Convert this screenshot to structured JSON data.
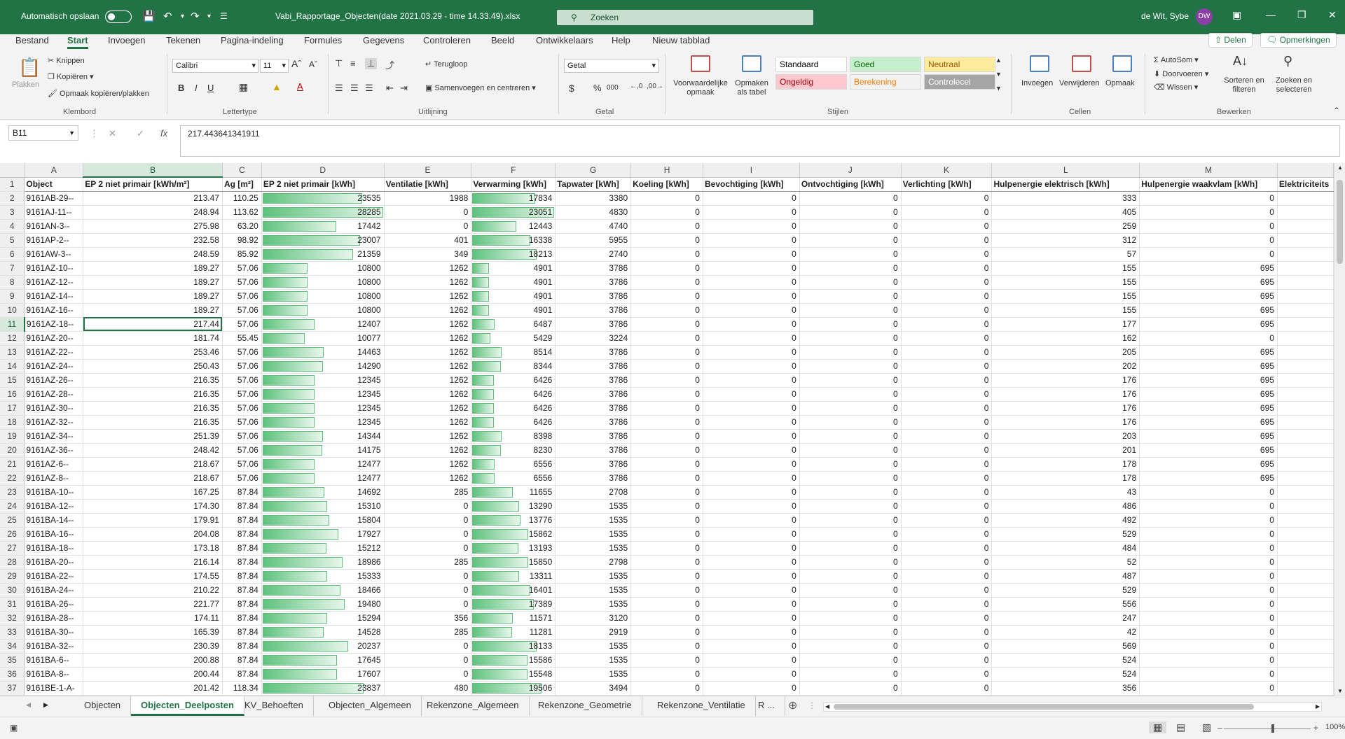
{
  "titlebar": {
    "autosave_label": "Automatisch opslaan",
    "doc_title": "Vabi_Rapportage_Objecten(date 2021.03.29 - time 14.33.49).xlsx",
    "search_placeholder": "Zoeken",
    "user_name": "de Wit, Sybe",
    "user_initials": "DW"
  },
  "tabs": [
    "Bestand",
    "Start",
    "Invoegen",
    "Tekenen",
    "Pagina-indeling",
    "Formules",
    "Gegevens",
    "Controleren",
    "Beeld",
    "Ontwikkelaars",
    "Help",
    "Nieuw tabblad"
  ],
  "active_tab": "Start",
  "share": {
    "share_label": "Delen",
    "comments_label": "Opmerkingen"
  },
  "ribbon": {
    "clipboard": {
      "paste": "Plakken",
      "cut": "Knippen",
      "copy": "Kopiëren",
      "format_painter": "Opmaak kopiëren/plakken",
      "group": "Klembord"
    },
    "font": {
      "family": "Calibri",
      "size": "11",
      "group": "Lettertype"
    },
    "alignment": {
      "wrap": "Terugloop",
      "merge": "Samenvoegen en centreren",
      "group": "Uitlijning"
    },
    "number": {
      "format": "Getal",
      "group": "Getal"
    },
    "styles": {
      "conditional": "Voorwaardelijke opmaak",
      "as_table": "Opmaken als tabel",
      "cells": [
        {
          "label": "Standaard",
          "bg": "#ffffff",
          "fg": "#000000"
        },
        {
          "label": "Goed",
          "bg": "#c6efce",
          "fg": "#006100"
        },
        {
          "label": "Neutraal",
          "bg": "#ffeb9c",
          "fg": "#9c5700"
        },
        {
          "label": "Ongeldig",
          "bg": "#ffc7ce",
          "fg": "#9c0006"
        },
        {
          "label": "Berekening",
          "bg": "#f2f2f2",
          "fg": "#fa7d00"
        },
        {
          "label": "Controlecel",
          "bg": "#a5a5a5",
          "fg": "#ffffff"
        }
      ],
      "group": "Stijlen"
    },
    "cells": {
      "insert": "Invoegen",
      "delete": "Verwijderen",
      "format": "Opmaak",
      "group": "Cellen"
    },
    "editing": {
      "autosum": "AutoSom",
      "fill": "Doorvoeren",
      "clear": "Wissen",
      "sort": "Sorteren en filteren",
      "find": "Zoeken en selecteren",
      "group": "Bewerken"
    }
  },
  "formula": {
    "name_box": "B11",
    "value": "217.443641341911"
  },
  "columns": [
    "A",
    "B",
    "C",
    "D",
    "E",
    "F",
    "G",
    "H",
    "I",
    "J",
    "K",
    "L",
    "M",
    ""
  ],
  "headers": [
    "Object",
    "EP 2 niet primair [kWh/m²]",
    "Ag [m²]",
    "EP 2 niet primair [kWh]",
    "Ventilatie [kWh]",
    "Verwarming [kWh]",
    "Tapwater [kWh]",
    "Koeling [kWh]",
    "Bevochtiging [kWh]",
    "Ontvochtiging [kWh]",
    "Verlichting [kWh]",
    "Hulpenergie elektrisch [kWh]",
    "Hulpenergie waakvlam [kWh]",
    "Elektriciteits"
  ],
  "rows": [
    [
      "9161AB-29--",
      "213.47",
      "110.25",
      "23535",
      "1988",
      "17834",
      "3380",
      "0",
      "0",
      "0",
      "0",
      "333",
      "0"
    ],
    [
      "9161AJ-11--",
      "248.94",
      "113.62",
      "28285",
      "0",
      "23051",
      "4830",
      "0",
      "0",
      "0",
      "0",
      "405",
      "0"
    ],
    [
      "9161AN-3--",
      "275.98",
      "63.20",
      "17442",
      "0",
      "12443",
      "4740",
      "0",
      "0",
      "0",
      "0",
      "259",
      "0"
    ],
    [
      "9161AP-2--",
      "232.58",
      "98.92",
      "23007",
      "401",
      "16338",
      "5955",
      "0",
      "0",
      "0",
      "0",
      "312",
      "0"
    ],
    [
      "9161AW-3--",
      "248.59",
      "85.92",
      "21359",
      "349",
      "18213",
      "2740",
      "0",
      "0",
      "0",
      "0",
      "57",
      "0"
    ],
    [
      "9161AZ-10--",
      "189.27",
      "57.06",
      "10800",
      "1262",
      "4901",
      "3786",
      "0",
      "0",
      "0",
      "0",
      "155",
      "695"
    ],
    [
      "9161AZ-12--",
      "189.27",
      "57.06",
      "10800",
      "1262",
      "4901",
      "3786",
      "0",
      "0",
      "0",
      "0",
      "155",
      "695"
    ],
    [
      "9161AZ-14--",
      "189.27",
      "57.06",
      "10800",
      "1262",
      "4901",
      "3786",
      "0",
      "0",
      "0",
      "0",
      "155",
      "695"
    ],
    [
      "9161AZ-16--",
      "189.27",
      "57.06",
      "10800",
      "1262",
      "4901",
      "3786",
      "0",
      "0",
      "0",
      "0",
      "155",
      "695"
    ],
    [
      "9161AZ-18--",
      "217.44",
      "57.06",
      "12407",
      "1262",
      "6487",
      "3786",
      "0",
      "0",
      "0",
      "0",
      "177",
      "695"
    ],
    [
      "9161AZ-20--",
      "181.74",
      "55.45",
      "10077",
      "1262",
      "5429",
      "3224",
      "0",
      "0",
      "0",
      "0",
      "162",
      "0"
    ],
    [
      "9161AZ-22--",
      "253.46",
      "57.06",
      "14463",
      "1262",
      "8514",
      "3786",
      "0",
      "0",
      "0",
      "0",
      "205",
      "695"
    ],
    [
      "9161AZ-24--",
      "250.43",
      "57.06",
      "14290",
      "1262",
      "8344",
      "3786",
      "0",
      "0",
      "0",
      "0",
      "202",
      "695"
    ],
    [
      "9161AZ-26--",
      "216.35",
      "57.06",
      "12345",
      "1262",
      "6426",
      "3786",
      "0",
      "0",
      "0",
      "0",
      "176",
      "695"
    ],
    [
      "9161AZ-28--",
      "216.35",
      "57.06",
      "12345",
      "1262",
      "6426",
      "3786",
      "0",
      "0",
      "0",
      "0",
      "176",
      "695"
    ],
    [
      "9161AZ-30--",
      "216.35",
      "57.06",
      "12345",
      "1262",
      "6426",
      "3786",
      "0",
      "0",
      "0",
      "0",
      "176",
      "695"
    ],
    [
      "9161AZ-32--",
      "216.35",
      "57.06",
      "12345",
      "1262",
      "6426",
      "3786",
      "0",
      "0",
      "0",
      "0",
      "176",
      "695"
    ],
    [
      "9161AZ-34--",
      "251.39",
      "57.06",
      "14344",
      "1262",
      "8398",
      "3786",
      "0",
      "0",
      "0",
      "0",
      "203",
      "695"
    ],
    [
      "9161AZ-36--",
      "248.42",
      "57.06",
      "14175",
      "1262",
      "8230",
      "3786",
      "0",
      "0",
      "0",
      "0",
      "201",
      "695"
    ],
    [
      "9161AZ-6--",
      "218.67",
      "57.06",
      "12477",
      "1262",
      "6556",
      "3786",
      "0",
      "0",
      "0",
      "0",
      "178",
      "695"
    ],
    [
      "9161AZ-8--",
      "218.67",
      "57.06",
      "12477",
      "1262",
      "6556",
      "3786",
      "0",
      "0",
      "0",
      "0",
      "178",
      "695"
    ],
    [
      "9161BA-10--",
      "167.25",
      "87.84",
      "14692",
      "285",
      "11655",
      "2708",
      "0",
      "0",
      "0",
      "0",
      "43",
      "0"
    ],
    [
      "9161BA-12--",
      "174.30",
      "87.84",
      "15310",
      "0",
      "13290",
      "1535",
      "0",
      "0",
      "0",
      "0",
      "486",
      "0"
    ],
    [
      "9161BA-14--",
      "179.91",
      "87.84",
      "15804",
      "0",
      "13776",
      "1535",
      "0",
      "0",
      "0",
      "0",
      "492",
      "0"
    ],
    [
      "9161BA-16--",
      "204.08",
      "87.84",
      "17927",
      "0",
      "15862",
      "1535",
      "0",
      "0",
      "0",
      "0",
      "529",
      "0"
    ],
    [
      "9161BA-18--",
      "173.18",
      "87.84",
      "15212",
      "0",
      "13193",
      "1535",
      "0",
      "0",
      "0",
      "0",
      "484",
      "0"
    ],
    [
      "9161BA-20--",
      "216.14",
      "87.84",
      "18986",
      "285",
      "15850",
      "2798",
      "0",
      "0",
      "0",
      "0",
      "52",
      "0"
    ],
    [
      "9161BA-22--",
      "174.55",
      "87.84",
      "15333",
      "0",
      "13311",
      "1535",
      "0",
      "0",
      "0",
      "0",
      "487",
      "0"
    ],
    [
      "9161BA-24--",
      "210.22",
      "87.84",
      "18466",
      "0",
      "16401",
      "1535",
      "0",
      "0",
      "0",
      "0",
      "529",
      "0"
    ],
    [
      "9161BA-26--",
      "221.77",
      "87.84",
      "19480",
      "0",
      "17389",
      "1535",
      "0",
      "0",
      "0",
      "0",
      "556",
      "0"
    ],
    [
      "9161BA-28--",
      "174.11",
      "87.84",
      "15294",
      "356",
      "11571",
      "3120",
      "0",
      "0",
      "0",
      "0",
      "247",
      "0"
    ],
    [
      "9161BA-30--",
      "165.39",
      "87.84",
      "14528",
      "285",
      "11281",
      "2919",
      "0",
      "0",
      "0",
      "0",
      "42",
      "0"
    ],
    [
      "9161BA-32--",
      "230.39",
      "87.84",
      "20237",
      "0",
      "18133",
      "1535",
      "0",
      "0",
      "0",
      "0",
      "569",
      "0"
    ],
    [
      "9161BA-6--",
      "200.88",
      "87.84",
      "17645",
      "0",
      "15586",
      "1535",
      "0",
      "0",
      "0",
      "0",
      "524",
      "0"
    ],
    [
      "9161BA-8--",
      "200.44",
      "87.84",
      "17607",
      "0",
      "15548",
      "1535",
      "0",
      "0",
      "0",
      "0",
      "524",
      "0"
    ],
    [
      "9161BE-1-A-",
      "201.42",
      "118.34",
      "23837",
      "480",
      "19506",
      "3494",
      "0",
      "0",
      "0",
      "0",
      "356",
      "0"
    ]
  ],
  "data_bars": {
    "D": {
      "max": 28285
    },
    "F": {
      "max": 23051
    }
  },
  "selected": {
    "row": 11,
    "col": "B"
  },
  "sheets": [
    "Objecten",
    "Objecten_Deelposten",
    "KV_Behoeften",
    "Objecten_Algemeen",
    "Rekenzone_Algemeen",
    "Rekenzone_Geometrie",
    "Rekenzone_Ventilatie",
    "R ..."
  ],
  "active_sheet": "Objecten_Deelposten",
  "status": {
    "zoom": "100%"
  }
}
